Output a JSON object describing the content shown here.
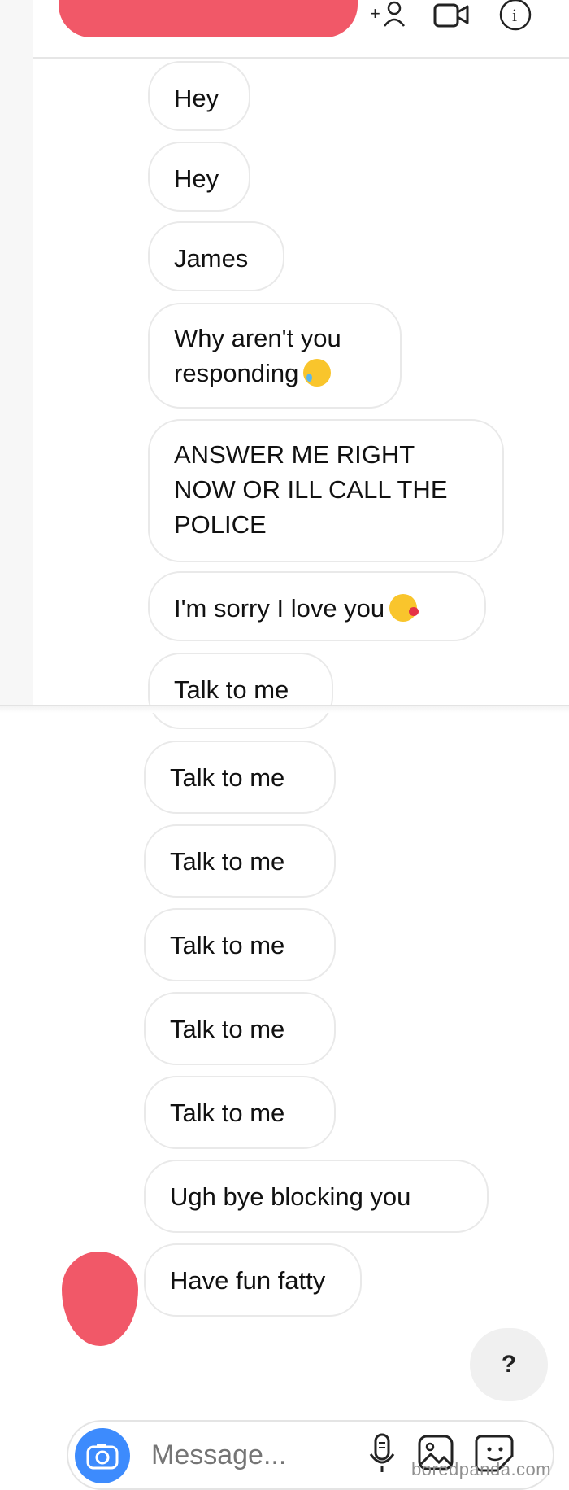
{
  "header": {
    "icons": [
      "add-person-icon",
      "video-call-icon",
      "info-icon"
    ]
  },
  "messages": [
    {
      "text": "Hey"
    },
    {
      "text": "Hey"
    },
    {
      "text": "James"
    },
    {
      "text": "Why aren't you\nresponding",
      "emoji": "sad-face-emoji"
    },
    {
      "text": "ANSWER ME RIGHT\nNOW OR ILL CALL THE\nPOLICE"
    },
    {
      "text": "I'm sorry I love you",
      "emoji": "kiss-face-emoji"
    },
    {
      "text": "Talk to me"
    },
    {
      "text": "Talk to me"
    },
    {
      "text": "Talk to me"
    },
    {
      "text": "Talk to me"
    },
    {
      "text": "Talk to me"
    },
    {
      "text": "Talk to me"
    },
    {
      "text": "Ugh bye blocking you"
    },
    {
      "text": "Have fun fatty"
    }
  ],
  "help_button": {
    "label": "?"
  },
  "composer": {
    "placeholder": "Message...",
    "icons": [
      "camera-icon",
      "microphone-icon",
      "gallery-icon",
      "sticker-icon"
    ]
  },
  "watermark": {
    "text": "boredpanda.com"
  },
  "colors": {
    "redaction": "#f15868",
    "bubble_border": "#e9e9e9",
    "camera_button": "#3d8bfd"
  }
}
